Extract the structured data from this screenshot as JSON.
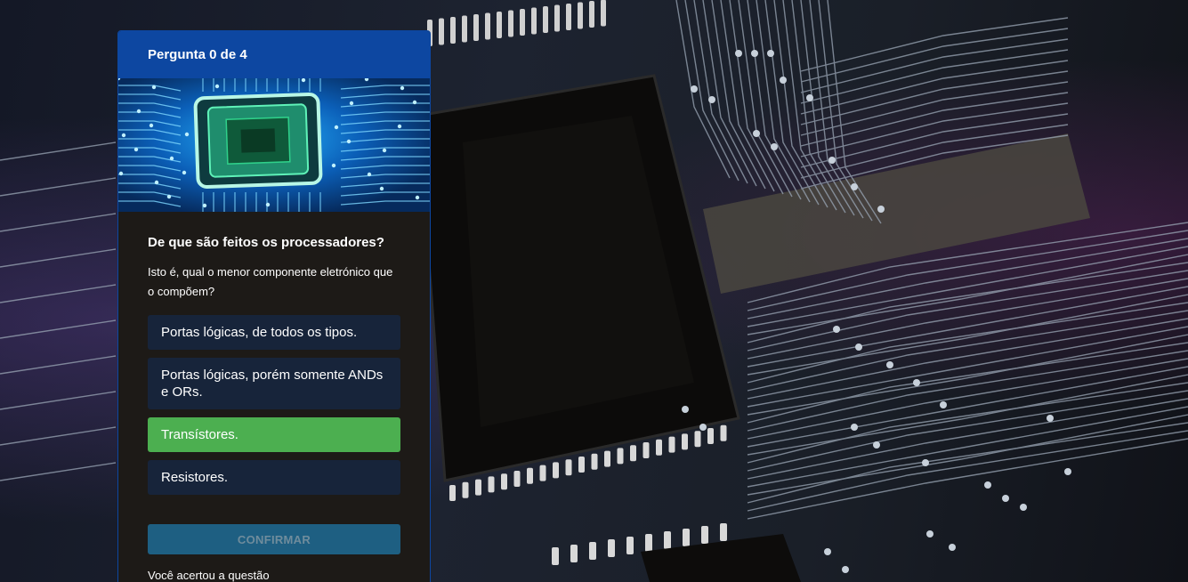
{
  "quiz": {
    "header": "Pergunta 0 de 4",
    "question": "De que são feitos os processadores?",
    "description": "Isto é, qual o menor componente eletrónico que o compõem?",
    "options": [
      {
        "label": "Portas lógicas, de todos os tipos.",
        "selected": false
      },
      {
        "label": "Portas lógicas, porém somente ANDs e ORs.",
        "selected": false
      },
      {
        "label": "Transístores.",
        "selected": true
      },
      {
        "label": "Resistores.",
        "selected": false
      }
    ],
    "confirm_label": "Confirmar",
    "feedback": "Você acertou a questão"
  },
  "colors": {
    "header_bg": "#0d47a1",
    "card_bg": "#1d1a17",
    "option_bg": "#17243a",
    "selected_option_bg": "#4caf50",
    "confirm_bg": "#1e5f82"
  },
  "icons": {
    "background": "circuit-board-image",
    "card_image": "processor-chip-image"
  }
}
